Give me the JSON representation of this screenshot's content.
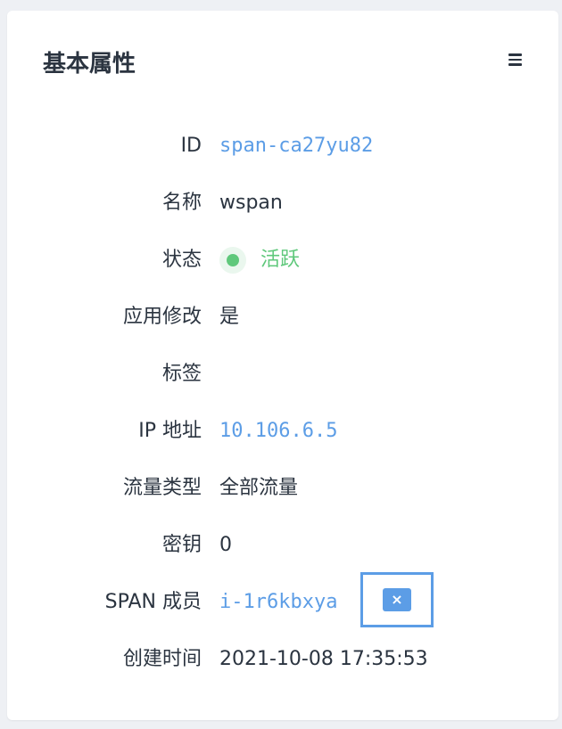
{
  "card": {
    "title": "基本属性",
    "menu_icon": "hamburger-menu-icon"
  },
  "rows": [
    {
      "label": "ID",
      "value": "span-ca27yu82"
    },
    {
      "label": "名称",
      "value": "wspan"
    },
    {
      "label": "状态",
      "value": "活跃",
      "status_color": "#5fc87b"
    },
    {
      "label": "应用修改",
      "value": "是"
    },
    {
      "label": "标签",
      "value": ""
    },
    {
      "label": "IP 地址",
      "value": "10.106.6.5"
    },
    {
      "label": "流量类型",
      "value": "全部流量"
    },
    {
      "label": "密钥",
      "value": "0"
    },
    {
      "label": "SPAN 成员",
      "value": "i-1r6kbxya",
      "remove_label": "×"
    },
    {
      "label": "创建时间",
      "value": "2021-10-08 17:35:53"
    }
  ],
  "colors": {
    "accent": "#5c9de6",
    "success": "#5fc87b",
    "text": "#2b3440",
    "background": "#eef0f4"
  }
}
